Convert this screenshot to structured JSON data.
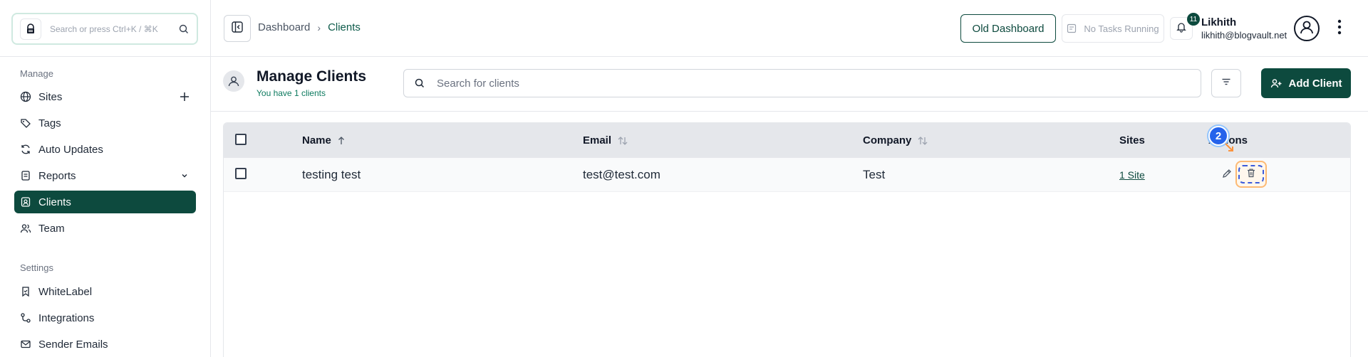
{
  "sidebar": {
    "search_placeholder": "Search or press Ctrl+K / ⌘K",
    "manage_heading": "Manage",
    "settings_heading": "Settings",
    "items": [
      {
        "label": "Sites",
        "icon": "globe-icon"
      },
      {
        "label": "Tags",
        "icon": "tags-icon"
      },
      {
        "label": "Auto Updates",
        "icon": "refresh-icon"
      },
      {
        "label": "Reports",
        "icon": "report-icon"
      },
      {
        "label": "Clients",
        "icon": "client-icon"
      },
      {
        "label": "Team",
        "icon": "team-icon"
      }
    ],
    "settings_items": [
      {
        "label": "WhiteLabel",
        "icon": "bookmark-icon"
      },
      {
        "label": "Integrations",
        "icon": "integrations-icon"
      },
      {
        "label": "Sender Emails",
        "icon": "mail-icon"
      }
    ],
    "active_item": "Clients"
  },
  "topbar": {
    "breadcrumb_parent": "Dashboard",
    "breadcrumb_separator": "›",
    "breadcrumb_current": "Clients",
    "old_dashboard_label": "Old Dashboard",
    "tasks_label": "No Tasks Running",
    "notification_count": "11",
    "user_name": "Likhith",
    "user_email": "likhith@blogvault.net"
  },
  "page": {
    "title": "Manage Clients",
    "subtitle": "You have 1 clients",
    "search_placeholder": "Search for clients",
    "add_client_label": "Add Client"
  },
  "table": {
    "headers": {
      "name": "Name",
      "email": "Email",
      "company": "Company",
      "sites": "Sites",
      "actions": "Actions"
    },
    "rows": [
      {
        "name": "testing test",
        "email": "test@test.com",
        "company": "Test",
        "sites": "1 Site"
      }
    ]
  },
  "annotation": {
    "step_number": "2"
  },
  "colors": {
    "brand": "#0d4a3e",
    "highlight_border": "#fdba74",
    "step_badge": "#2563eb"
  }
}
